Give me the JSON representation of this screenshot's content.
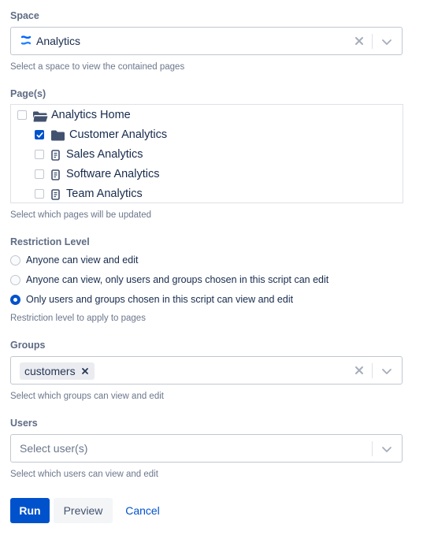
{
  "space": {
    "label": "Space",
    "value": "Analytics",
    "help": "Select a space to view the contained pages",
    "icon": "confluence-space-icon"
  },
  "pages": {
    "label": "Page(s)",
    "help": "Select which pages will be updated",
    "items": [
      {
        "label": "Analytics Home",
        "checked": false,
        "icon": "folder-open-icon"
      },
      {
        "label": "Customer Analytics",
        "checked": true,
        "icon": "folder-icon"
      },
      {
        "label": "Sales Analytics",
        "checked": false,
        "icon": "page-icon"
      },
      {
        "label": "Software Analytics",
        "checked": false,
        "icon": "page-icon"
      },
      {
        "label": "Team Analytics",
        "checked": false,
        "icon": "page-icon"
      }
    ]
  },
  "restriction": {
    "label": "Restriction Level",
    "help": "Restriction level to apply to pages",
    "options": [
      {
        "label": "Anyone can view and edit",
        "selected": false
      },
      {
        "label": "Anyone can view, only users and groups chosen in this script can edit",
        "selected": false
      },
      {
        "label": "Only users and groups chosen in this script can view and edit",
        "selected": true
      }
    ]
  },
  "groups": {
    "label": "Groups",
    "chip": "customers",
    "help": "Select which groups can view and edit"
  },
  "users": {
    "label": "Users",
    "placeholder": "Select user(s)",
    "help": "Select which users can view and edit"
  },
  "actions": {
    "run": "Run",
    "preview": "Preview",
    "cancel": "Cancel"
  },
  "colors": {
    "accent": "#0052cc",
    "text": "#172b4d",
    "subtle": "#6b778c",
    "border": "#c1c7d0"
  }
}
